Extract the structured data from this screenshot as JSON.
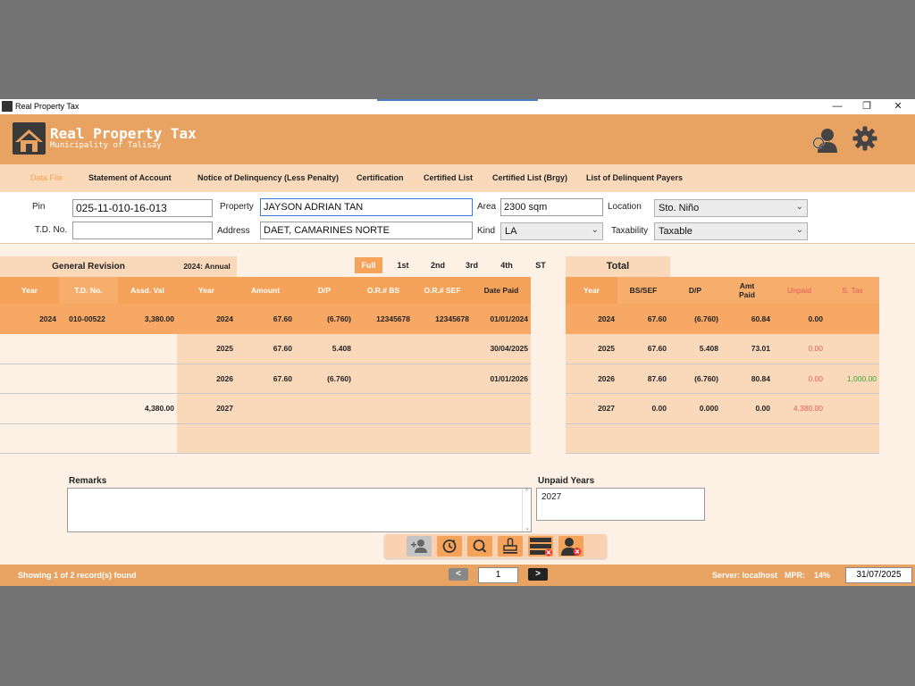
{
  "window": {
    "title": "Real Property Tax",
    "minimize": "—",
    "restore": "❐",
    "close": "✕"
  },
  "header": {
    "title": "Real Property Tax",
    "subtitle": "Municipality of Talisay"
  },
  "menu": {
    "items": [
      {
        "label": "Data File",
        "active": true
      },
      {
        "label": "Statement of Account"
      },
      {
        "label": "Notice of Delinquency (Less Penalty)"
      },
      {
        "label": "Certification"
      },
      {
        "label": "Certified List"
      },
      {
        "label": "Certified List (Brgy)"
      },
      {
        "label": "List of Delinquent Payers"
      }
    ]
  },
  "form": {
    "pin_label": "Pin",
    "pin_value": "025-11-010-16-013",
    "td_label": "T.D. No.",
    "td_value": "",
    "property_label": "Property",
    "property_value": "JAYSON ADRIAN TAN",
    "address_label": "Address",
    "address_value": "DAET, CAMARINES NORTE",
    "area_label": "Area",
    "area_value": "2300 sqm",
    "kind_label": "Kind",
    "kind_value": "LA",
    "location_label": "Location",
    "location_value": "Sto. Niño",
    "taxability_label": "Taxability",
    "taxability_value": "Taxable"
  },
  "general_revision": {
    "title": "General Revision",
    "headers": [
      "Year",
      "T.D. No.",
      "Assd. Val"
    ],
    "rows": [
      [
        "2024",
        "010-00522",
        "3,380.00"
      ],
      [
        "",
        "",
        ""
      ],
      [
        "",
        "",
        ""
      ],
      [
        "",
        "",
        "4,380.00"
      ],
      [
        "",
        "",
        ""
      ]
    ]
  },
  "payments": {
    "tab_label": "2024: Annual",
    "periods": [
      "Full",
      "1st",
      "2nd",
      "3rd",
      "4th",
      "ST"
    ],
    "headers": [
      "Year",
      "Amount",
      "D/P",
      "O.R.# BS",
      "O.R.# SEF",
      "Date Paid"
    ],
    "rows": [
      [
        "2024",
        "67.60",
        "(6.760)",
        "12345678",
        "12345678",
        "01/01/2024"
      ],
      [
        "2025",
        "67.60",
        "5.408",
        "",
        "",
        "30/04/2025"
      ],
      [
        "2026",
        "67.60",
        "(6.760)",
        "",
        "",
        "01/01/2026"
      ],
      [
        "2027",
        "",
        "",
        "",
        "",
        ""
      ],
      [
        "",
        "",
        "",
        "",
        "",
        ""
      ]
    ]
  },
  "total": {
    "title": "Total",
    "headers": [
      "Year",
      "BS/SEF",
      "D/P",
      "Amt Paid",
      "Unpaid",
      "S. Tax"
    ],
    "rows": [
      [
        "2024",
        "67.60",
        "(6.760)",
        "60.84",
        "0.00",
        ""
      ],
      [
        "2025",
        "67.60",
        "5.408",
        "73.01",
        "0.00",
        ""
      ],
      [
        "2026",
        "87.60",
        "(6.760)",
        "80.84",
        "0.00",
        "1,000.00"
      ],
      [
        "2027",
        "0.00",
        "0.000",
        "0.00",
        "4,380.00",
        ""
      ],
      [
        "",
        "",
        "",
        "",
        "",
        ""
      ]
    ]
  },
  "remarks": {
    "label": "Remarks",
    "value": ""
  },
  "unpaid_years": {
    "label": "Unpaid Years",
    "value": "2027"
  },
  "toolbar": {
    "icons": [
      "add-user-icon",
      "history-icon",
      "search-icon",
      "stamp-icon",
      "delete-records-icon",
      "delete-user-icon"
    ]
  },
  "status": {
    "records": "Showing 1 of 2 record(s) found",
    "prev": "<",
    "page": "1",
    "next": ">",
    "server": "Server: localhost",
    "mpr_label": "MPR:",
    "mpr_value": "14%",
    "date": "31/07/2025"
  },
  "colors": {
    "accent": "#e8a261",
    "header_cell": "#f5a25a",
    "unpaid_red": "#e35d5d",
    "stax_green": "#3aa835"
  }
}
